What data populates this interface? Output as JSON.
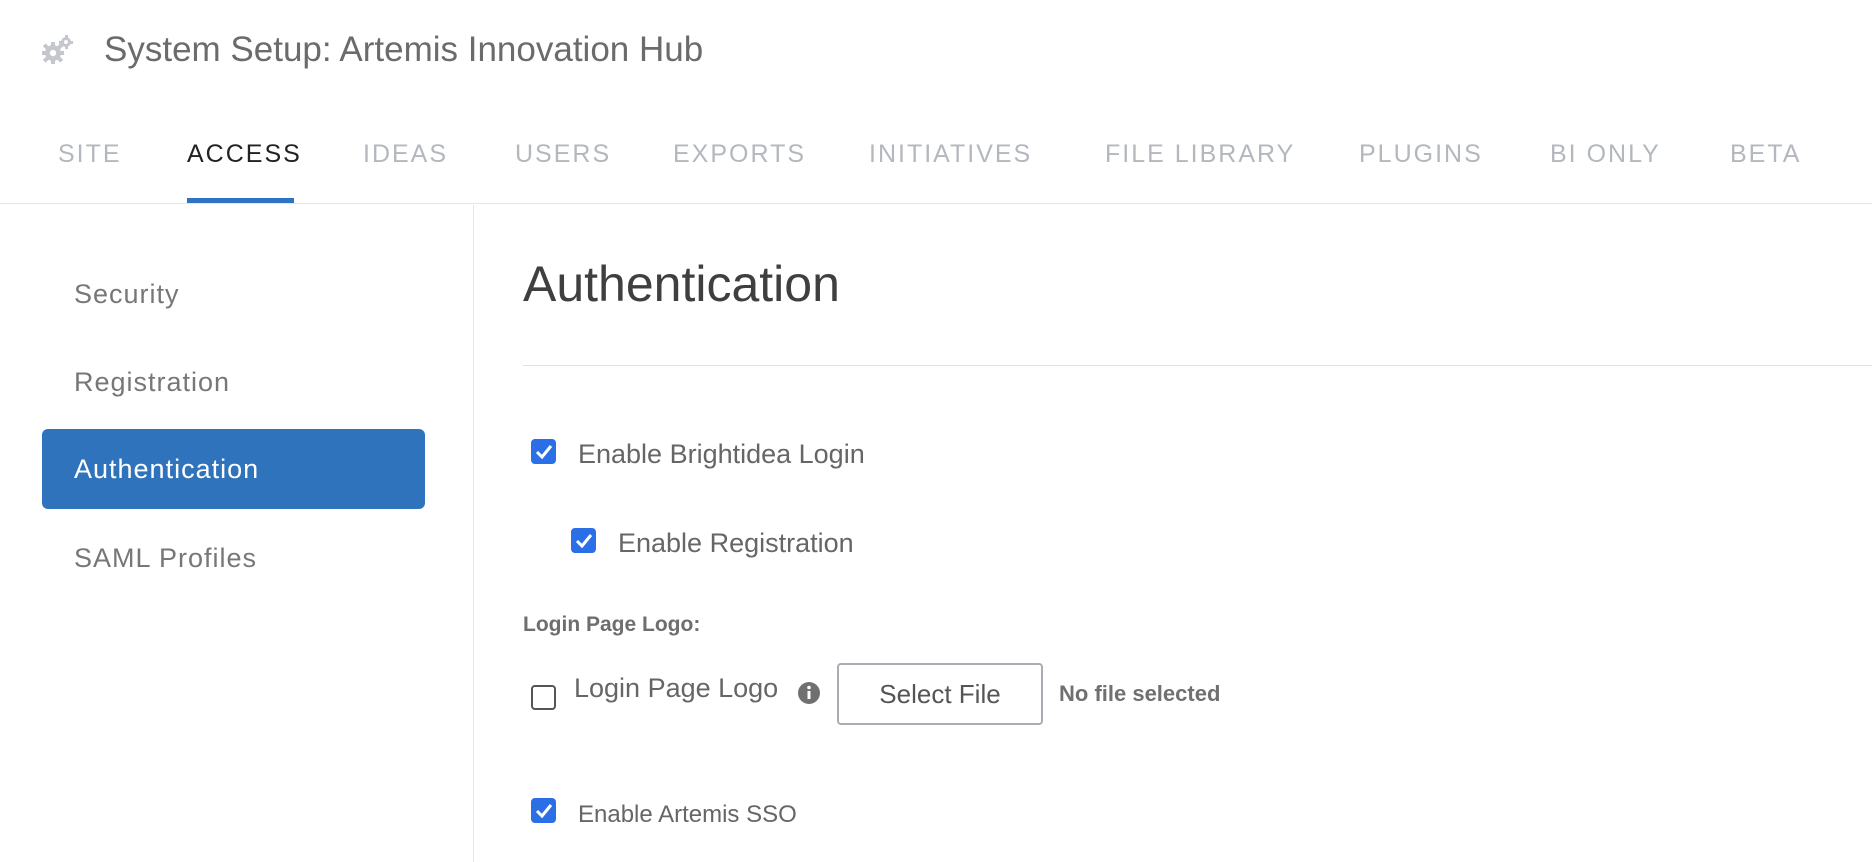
{
  "header": {
    "title": "System Setup: Artemis Innovation Hub",
    "icon": "gear-icon"
  },
  "tabs": [
    {
      "label": "SITE",
      "active": false
    },
    {
      "label": "ACCESS",
      "active": true
    },
    {
      "label": "IDEAS",
      "active": false
    },
    {
      "label": "USERS",
      "active": false
    },
    {
      "label": "EXPORTS",
      "active": false
    },
    {
      "label": "INITIATIVES",
      "active": false
    },
    {
      "label": "FILE LIBRARY",
      "active": false
    },
    {
      "label": "PLUGINS",
      "active": false
    },
    {
      "label": "BI ONLY",
      "active": false
    },
    {
      "label": "BETA",
      "active": false
    }
  ],
  "sidebar": {
    "items": [
      {
        "label": "Security",
        "active": false
      },
      {
        "label": "Registration",
        "active": false
      },
      {
        "label": "Authentication",
        "active": true
      },
      {
        "label": "SAML Profiles",
        "active": false
      }
    ]
  },
  "main": {
    "title": "Authentication",
    "enable_login": {
      "label": "Enable Brightidea Login",
      "checked": true
    },
    "enable_registration": {
      "label": "Enable Registration",
      "checked": true
    },
    "logo_heading": "Login Page Logo:",
    "logo": {
      "label": "Login Page Logo",
      "checked": false,
      "icon": "info-icon",
      "button_label": "Select File",
      "status": "No file selected"
    },
    "enable_sso": {
      "label": "Enable Artemis SSO",
      "checked": true
    }
  },
  "colors": {
    "accent": "#2f73bc",
    "checkbox": "#2a6fe6",
    "tab_inactive": "#b3b8bf",
    "tab_active": "#222222"
  }
}
